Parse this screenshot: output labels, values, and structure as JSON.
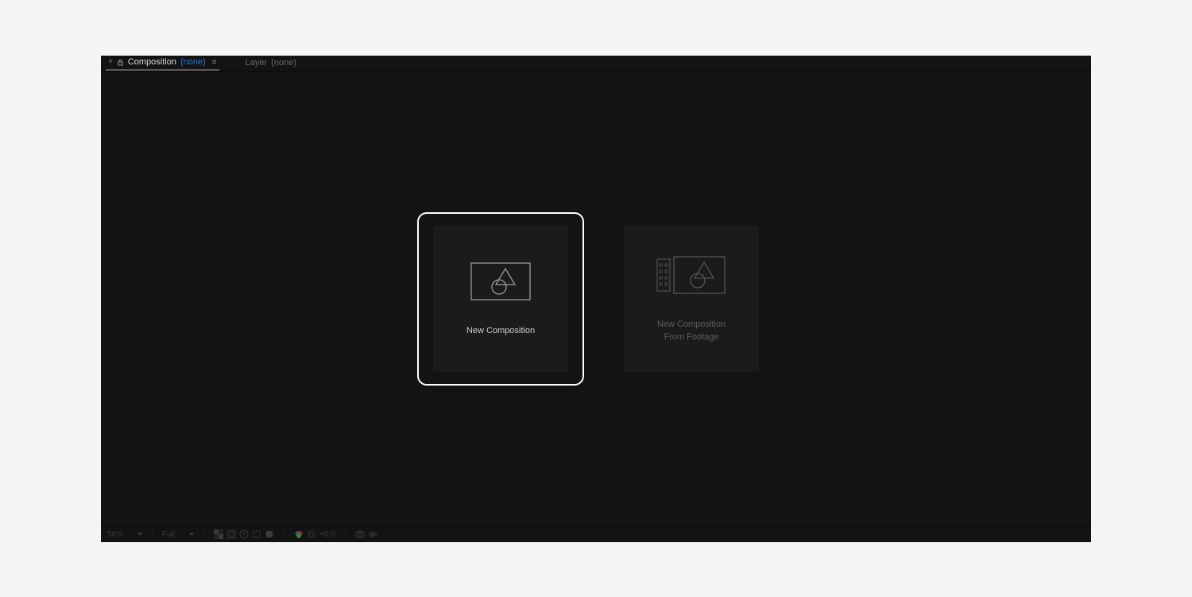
{
  "tabs": {
    "composition": {
      "label": "Composition",
      "suffix": "(none)"
    },
    "layer": {
      "label": "Layer",
      "suffix": "(none)"
    }
  },
  "cards": {
    "new_comp": {
      "label": "New Composition"
    },
    "new_comp_from_footage": {
      "label": "New Composition\nFrom Footage"
    }
  },
  "footer": {
    "zoom": "50%",
    "resolution": "Full",
    "exposure": "+0.0"
  }
}
